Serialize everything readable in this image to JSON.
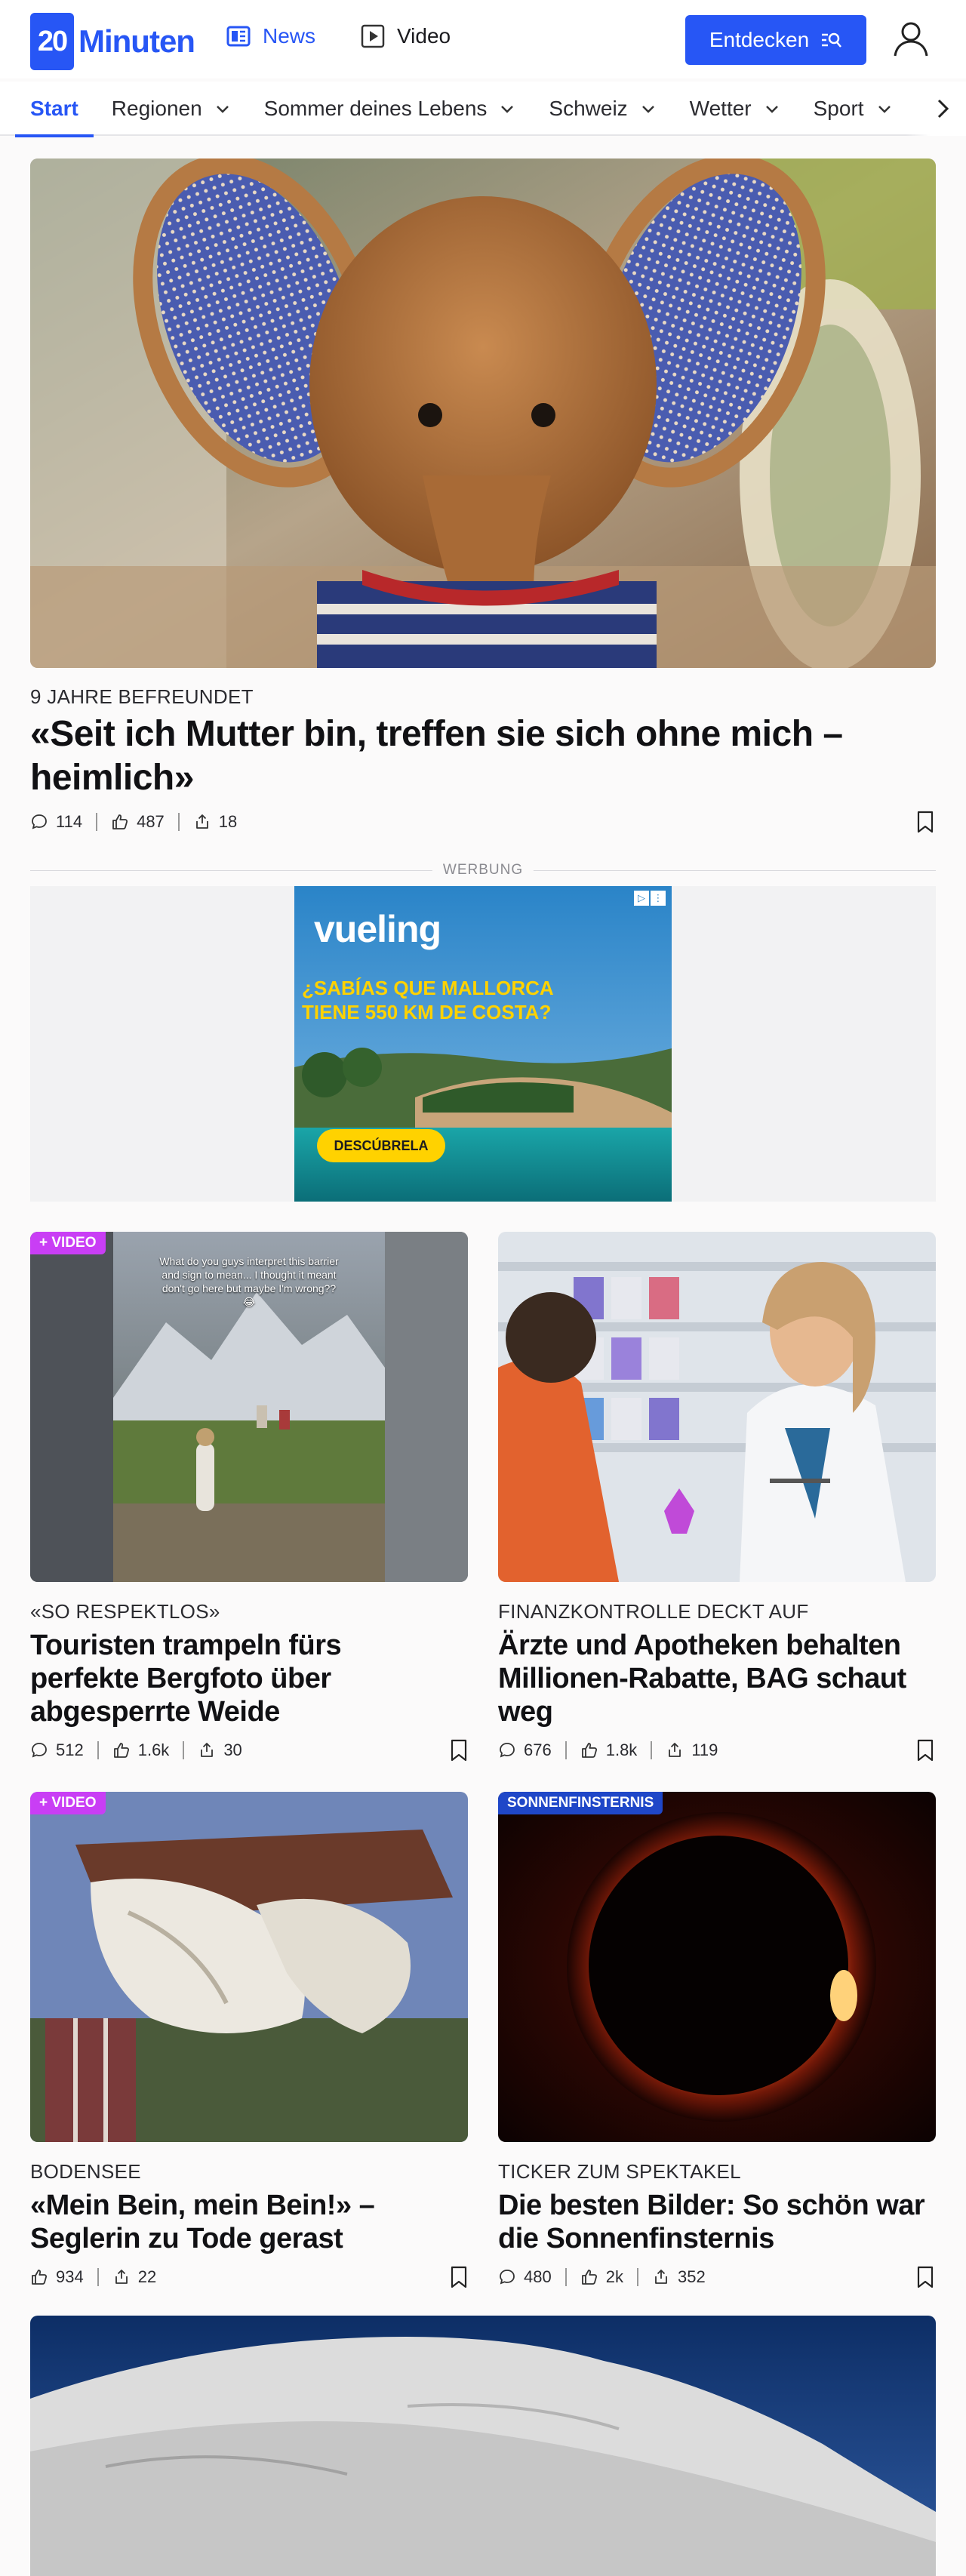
{
  "header": {
    "logo_text": "Minuten",
    "logo_mark": "20",
    "nav": [
      {
        "label": "News",
        "icon": "news-icon"
      },
      {
        "label": "Video",
        "icon": "video-play-icon"
      }
    ],
    "discover_label": "Entdecken",
    "accent": "#2756f5"
  },
  "categories": [
    {
      "label": "Start"
    },
    {
      "label": "Regionen"
    },
    {
      "label": "Sommer deines Lebens"
    },
    {
      "label": "Schweiz"
    },
    {
      "label": "Wetter"
    },
    {
      "label": "Sport"
    }
  ],
  "hero": {
    "kicker": "9 JAHRE BEFREUNDET",
    "headline": "«Seit ich Mutter bin, treffen sie sich ohne mich – heimlich»",
    "comments": "114",
    "likes": "487",
    "shares": "18"
  },
  "ad": {
    "label": "WERBUNG",
    "brand": "vueling",
    "line1": "¿SABÍAS QUE MALLORCA",
    "line2": "TIENE 550 KM DE COSTA?",
    "cta": "DESCÚBRELA"
  },
  "articles": [
    {
      "badge": "+ VIDEO",
      "video_caption": "What do you guys interpret this barrier and sign to mean... I thought it meant don't go here but maybe I'm wrong?? 😂",
      "kicker": "«SO RESPEKTLOS»",
      "headline": "Touristen trampeln fürs perfekte Bergfoto über abgesperrte Weide",
      "comments": "512",
      "likes": "1.6k",
      "shares": "30"
    },
    {
      "badge": "",
      "kicker": "FINANZKONTROLLE DECKT AUF",
      "headline": "Ärzte und Apotheken behalten Millionen-Rabatte, BAG schaut weg",
      "comments": "676",
      "likes": "1.8k",
      "shares": "119"
    },
    {
      "badge": "+ VIDEO",
      "kicker": "BODENSEE",
      "headline": "«Mein Bein, mein Bein!» – Seglerin zu Tode gerast",
      "likes": "934",
      "shares": "22"
    },
    {
      "badge": "SONNENFINSTERNIS",
      "kicker": "TICKER ZUM SPEKTAKEL",
      "headline": "Die besten Bilder: So schön war die Sonnenfinsternis",
      "comments": "480",
      "likes": "2k",
      "shares": "352"
    }
  ]
}
